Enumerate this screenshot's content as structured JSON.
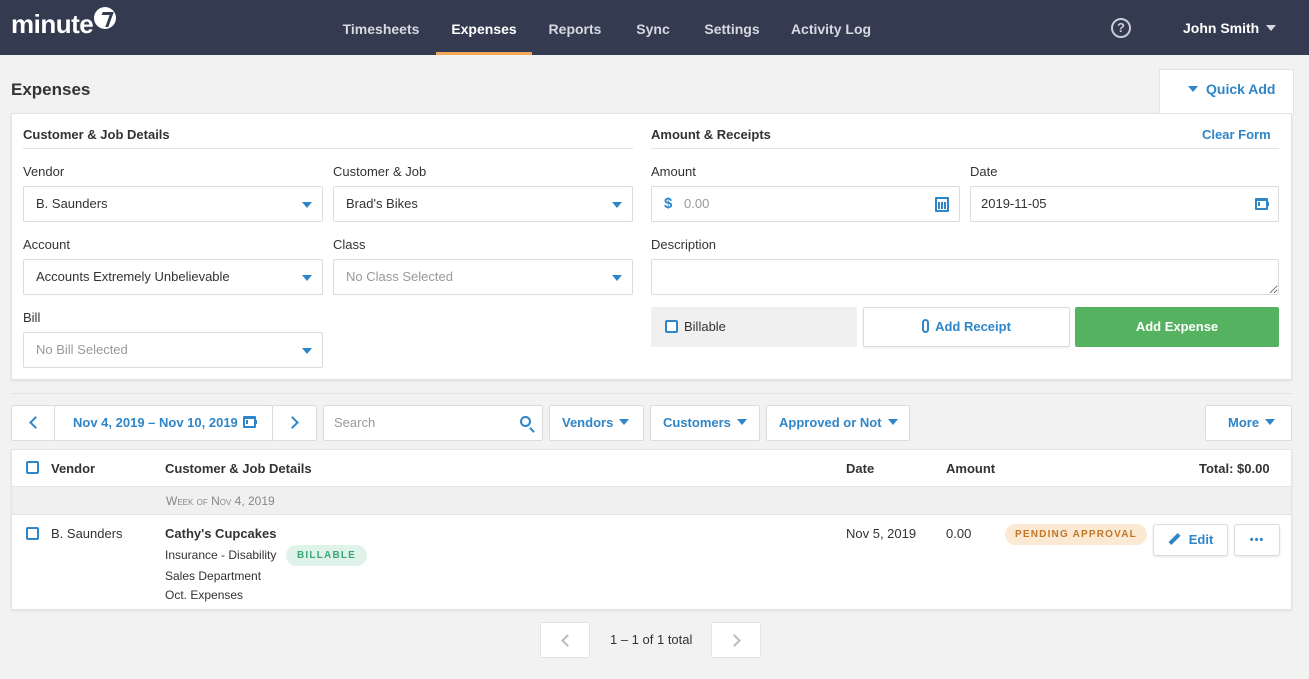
{
  "app": {
    "brand": "minute"
  },
  "nav": {
    "tabs": [
      "Timesheets",
      "Expenses",
      "Reports",
      "Sync",
      "Settings",
      "Activity Log"
    ],
    "active_tab": "Expenses",
    "help": "?",
    "user": "John Smith"
  },
  "page": {
    "title": "Expenses",
    "quick_add": "Quick Add"
  },
  "form": {
    "customer_section": "Customer & Job Details",
    "amount_section": "Amount & Receipts",
    "clear_form": "Clear Form",
    "vendor": {
      "label": "Vendor",
      "value": "B. Saunders"
    },
    "customer_job": {
      "label": "Customer & Job",
      "value": "Brad's Bikes"
    },
    "account": {
      "label": "Account",
      "value": "Accounts Extremely Unbelievable"
    },
    "class": {
      "label": "Class",
      "placeholder": "No Class Selected"
    },
    "bill": {
      "label": "Bill",
      "placeholder": "No Bill Selected"
    },
    "amount": {
      "label": "Amount",
      "currency": "$",
      "placeholder": "0.00"
    },
    "date": {
      "label": "Date",
      "value": "2019-11-05"
    },
    "description": {
      "label": "Description",
      "value": ""
    },
    "billable": {
      "label": "Billable",
      "checked": false
    },
    "add_receipt": "Add Receipt",
    "add_expense": "Add Expense"
  },
  "toolbar": {
    "date_range": "Nov 4, 2019 – Nov 10, 2019",
    "search_placeholder": "Search",
    "filters": [
      "Vendors",
      "Customers",
      "Approved or Not"
    ],
    "more": "More"
  },
  "table": {
    "headers": {
      "vendor": "Vendor",
      "details": "Customer & Job Details",
      "date": "Date",
      "amount": "Amount",
      "total": "Total: $0.00"
    },
    "group": "Week of Nov 4, 2019",
    "rows": [
      {
        "vendor": "B. Saunders",
        "customer": "Cathy's Cupcakes",
        "account": "Insurance - Disability",
        "billable_badge": "BILLABLE",
        "class": "Sales Department",
        "bill": "Oct. Expenses",
        "date": "Nov 5, 2019",
        "amount": "0.00",
        "status": "PENDING APPROVAL",
        "edit": "Edit",
        "more": "•••"
      }
    ]
  },
  "pagination": {
    "text": "1 – 1 of 1 total"
  },
  "colors": {
    "nav_bg": "#343a4f",
    "accent": "#2e86c9",
    "active_underline": "#f2a65a",
    "add_expense": "#55b261"
  }
}
